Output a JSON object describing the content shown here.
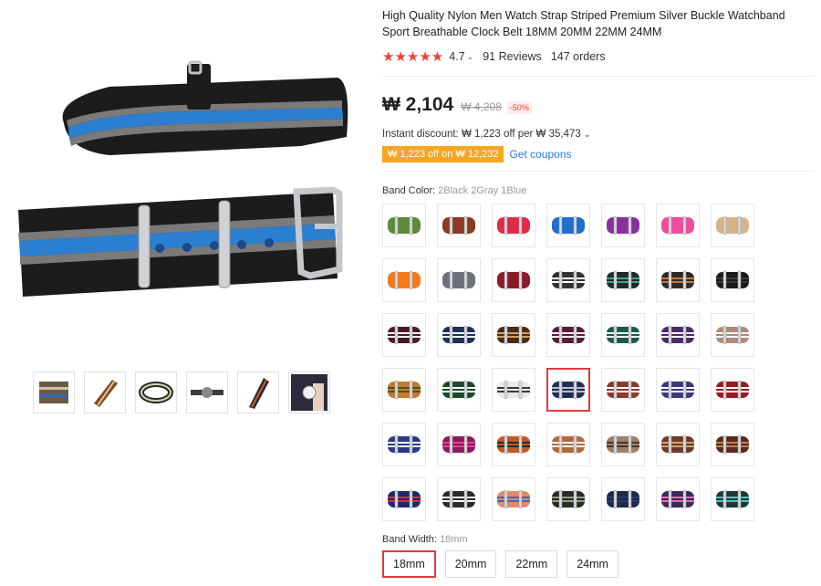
{
  "product": {
    "title": "High Quality Nylon Men Watch Strap Striped Premium Silver Buckle Watchband Sport Breathable Clock Belt 18MM 20MM 22MM 24MM",
    "rating": "4.7",
    "stars": "★★★★★",
    "reviews": "91 Reviews",
    "orders": "147 orders"
  },
  "price": {
    "current": "₩ 2,104",
    "original": "₩ 4,208",
    "discount": "-50%",
    "instant_discount": "Instant discount: ₩ 1,223 off per ₩ 35,473",
    "coupon_tag": "₩ 1,223 off on ₩ 12,232",
    "get_coupons": "Get coupons"
  },
  "band_color": {
    "label": "Band Color:",
    "selected": "2Black 2Gray 1Blue",
    "swatches": [
      {
        "colors": [
          "#5d8a3a"
        ]
      },
      {
        "colors": [
          "#8a3b22"
        ]
      },
      {
        "colors": [
          "#e02a4a"
        ]
      },
      {
        "colors": [
          "#1e6fd0"
        ]
      },
      {
        "colors": [
          "#8a2fa0"
        ]
      },
      {
        "colors": [
          "#f24aa0"
        ]
      },
      {
        "colors": [
          "#d4b48a"
        ]
      },
      {
        "colors": [
          "#f47a20"
        ]
      },
      {
        "colors": [
          "#6c7078"
        ]
      },
      {
        "colors": [
          "#8a1a26"
        ]
      },
      {
        "colors": [
          "#333333",
          "#ffffff",
          "#333333"
        ]
      },
      {
        "colors": [
          "#1f2a2a",
          "#3aa88a",
          "#1f2a2a"
        ]
      },
      {
        "colors": [
          "#2a2a2a",
          "#c87a30",
          "#2a2a2a"
        ]
      },
      {
        "colors": [
          "#1a1a1a",
          "#3a3a3a",
          "#1a1a1a"
        ]
      },
      {
        "colors": [
          "#4a1a2a",
          "#ffffff",
          "#4a1a2a"
        ]
      },
      {
        "colors": [
          "#1f2f5a",
          "#ffffff",
          "#1f2f5a"
        ]
      },
      {
        "colors": [
          "#4a2a1a",
          "#d0a060",
          "#4a2a1a"
        ]
      },
      {
        "colors": [
          "#5a1a3a",
          "#ffffff",
          "#5a1a3a"
        ]
      },
      {
        "colors": [
          "#1a5a4a",
          "#ffffff",
          "#1a5a4a"
        ]
      },
      {
        "colors": [
          "#4a2a6a",
          "#ffffff",
          "#4a2a6a"
        ]
      },
      {
        "colors": [
          "#b08a7a",
          "#ffffff",
          "#b08a7a"
        ]
      },
      {
        "colors": [
          "#c8782a",
          "#3a5a2a",
          "#c8782a"
        ]
      },
      {
        "colors": [
          "#1a4a2a",
          "#ffffff",
          "#1a4a2a"
        ]
      },
      {
        "colors": [
          "#e8e8e8",
          "#3a3a3a",
          "#e8e8e8"
        ]
      },
      {
        "colors": [
          "#1f2f5a",
          "#c0c0c0",
          "#1f2f5a"
        ]
      },
      {
        "colors": [
          "#8a3a2a",
          "#ffffff",
          "#8a3a2a"
        ]
      },
      {
        "colors": [
          "#3a3a7a",
          "#ffffff",
          "#3a3a7a"
        ]
      },
      {
        "colors": [
          "#9a1a22",
          "#ffffff",
          "#9a1a22"
        ]
      },
      {
        "colors": [
          "#2a3a8a",
          "#ffffff",
          "#2a3a8a"
        ]
      },
      {
        "colors": [
          "#8a1a5a",
          "#e040a0",
          "#8a1a5a"
        ]
      },
      {
        "colors": [
          "#c05a2a",
          "#2a2a2a",
          "#c05a2a"
        ]
      },
      {
        "colors": [
          "#b06a3a",
          "#ffffff",
          "#b06a3a"
        ]
      },
      {
        "colors": [
          "#a0806a",
          "#4a3a2a",
          "#a0806a"
        ]
      },
      {
        "colors": [
          "#6a3a2a",
          "#d0a070",
          "#6a3a2a"
        ]
      },
      {
        "colors": [
          "#5a2a1a",
          "#c08050",
          "#5a2a1a"
        ]
      },
      {
        "colors": [
          "#1a2a6a",
          "#e02a3a",
          "#1a2a6a"
        ]
      },
      {
        "colors": [
          "#2a2a2a",
          "#ffffff",
          "#2a2a2a"
        ]
      },
      {
        "colors": [
          "#e08a6a",
          "#3a6ac0",
          "#e08a6a"
        ]
      },
      {
        "colors": [
          "#2a2a2a",
          "#90a080",
          "#2a2a2a"
        ]
      },
      {
        "colors": [
          "#1a2a4a",
          "#2a3a6a",
          "#1a2a4a"
        ]
      },
      {
        "colors": [
          "#3a2a5a",
          "#e070b0",
          "#3a2a5a"
        ]
      },
      {
        "colors": [
          "#1a3a3a",
          "#5ac0c0",
          "#1a3a3a"
        ]
      }
    ],
    "selected_index": 24
  },
  "band_width": {
    "label": "Band Width:",
    "selected": "18mm",
    "options": [
      "18mm",
      "20mm",
      "22mm",
      "24mm"
    ]
  },
  "gallery": {
    "thumbnails": [
      "thumb-1",
      "thumb-2",
      "thumb-3",
      "thumb-4",
      "thumb-5",
      "thumb-6"
    ]
  }
}
